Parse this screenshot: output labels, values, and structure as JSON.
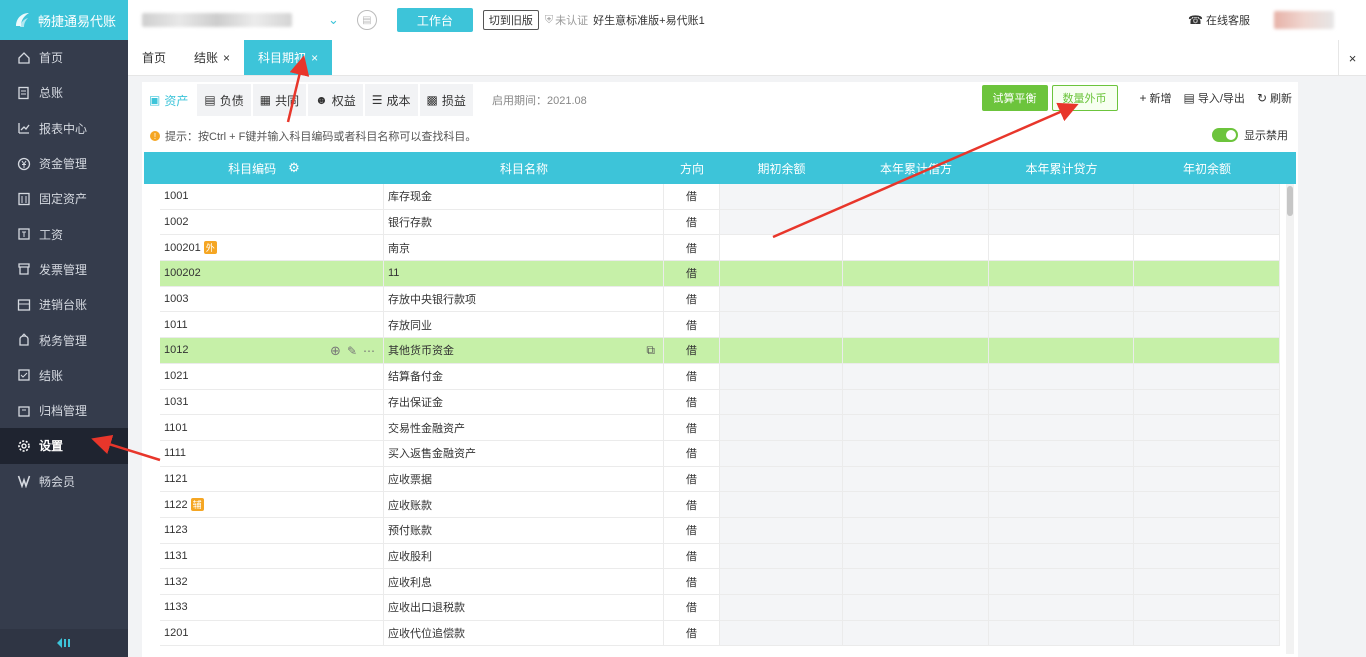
{
  "app": {
    "title": "畅捷通易代账"
  },
  "sidebar": {
    "items": [
      {
        "label": "首页",
        "icon": "home-icon"
      },
      {
        "label": "总账",
        "icon": "ledger-icon"
      },
      {
        "label": "报表中心",
        "icon": "chart-icon"
      },
      {
        "label": "资金管理",
        "icon": "money-icon"
      },
      {
        "label": "固定资产",
        "icon": "building-icon"
      },
      {
        "label": "工资",
        "icon": "salary-icon"
      },
      {
        "label": "发票管理",
        "icon": "invoice-icon"
      },
      {
        "label": "进销台账",
        "icon": "inventory-icon"
      },
      {
        "label": "税务管理",
        "icon": "tax-icon"
      },
      {
        "label": "结账",
        "icon": "close-account-icon"
      },
      {
        "label": "归档管理",
        "icon": "archive-icon"
      },
      {
        "label": "设置",
        "icon": "gear-icon"
      },
      {
        "label": "畅会员",
        "icon": "vip-icon"
      }
    ],
    "active_index": 11
  },
  "topbar": {
    "workbench_label": "工作台",
    "switch_old_label": "切到旧版",
    "cert_label": "未认证",
    "version_label": "好生意标准版+易代账1",
    "online_label": "在线客服"
  },
  "tabs": [
    {
      "label": "首页",
      "closable": false
    },
    {
      "label": "结账",
      "closable": true
    },
    {
      "label": "科目期初",
      "closable": true,
      "active": true
    }
  ],
  "tab_close_symbol": "×",
  "subtabs": [
    {
      "label": "资产",
      "active": true
    },
    {
      "label": "负债"
    },
    {
      "label": "共同"
    },
    {
      "label": "权益"
    },
    {
      "label": "成本"
    },
    {
      "label": "损益"
    }
  ],
  "period_label": "启用期间：2021.08",
  "actions": {
    "trial_balance": "试算平衡",
    "qty_fx": "数量外币",
    "add": "新增",
    "import_export": "导入/导出",
    "refresh": "刷新"
  },
  "hint": "提示：按Ctrl + F键并输入科目编码或者科目名称可以查找科目。",
  "toggle_label": "显示禁用",
  "table": {
    "headers": [
      "科目编码",
      "科目名称",
      "方向",
      "期初余额",
      "本年累计借方",
      "本年累计贷方",
      "年初余额"
    ],
    "rows": [
      {
        "code": "1001",
        "name": "库存现金",
        "dir": "借"
      },
      {
        "code": "1002",
        "name": "银行存款",
        "dir": "借"
      },
      {
        "code": "100201",
        "badge": "外",
        "name": "南京",
        "dir": "借"
      },
      {
        "code": "100202",
        "name": "11",
        "dir": "借",
        "highlight": true
      },
      {
        "code": "1003",
        "name": "存放中央银行款项",
        "dir": "借"
      },
      {
        "code": "1011",
        "name": "存放同业",
        "dir": "借"
      },
      {
        "code": "1012",
        "name": "其他货币资金",
        "dir": "借",
        "highlight": true,
        "tools": true
      },
      {
        "code": "1021",
        "name": "结算备付金",
        "dir": "借"
      },
      {
        "code": "1031",
        "name": "存出保证金",
        "dir": "借"
      },
      {
        "code": "1101",
        "name": "交易性金融资产",
        "dir": "借"
      },
      {
        "code": "1111",
        "name": "买入返售金融资产",
        "dir": "借"
      },
      {
        "code": "1121",
        "name": "应收票据",
        "dir": "借"
      },
      {
        "code": "1122",
        "badge": "辅",
        "name": "应收账款",
        "dir": "借"
      },
      {
        "code": "1123",
        "name": "预付账款",
        "dir": "借"
      },
      {
        "code": "1131",
        "name": "应收股利",
        "dir": "借"
      },
      {
        "code": "1132",
        "name": "应收利息",
        "dir": "借"
      },
      {
        "code": "1133",
        "name": "应收出口退税款",
        "dir": "借"
      },
      {
        "code": "1201",
        "name": "应收代位追偿款",
        "dir": "借"
      }
    ]
  },
  "colors": {
    "accent": "#3dc4d9",
    "sidebar": "#353c4c",
    "green": "#6cc43c",
    "highlight_row": "#c6f0a8",
    "annotation_arrow": "#e8362b"
  }
}
